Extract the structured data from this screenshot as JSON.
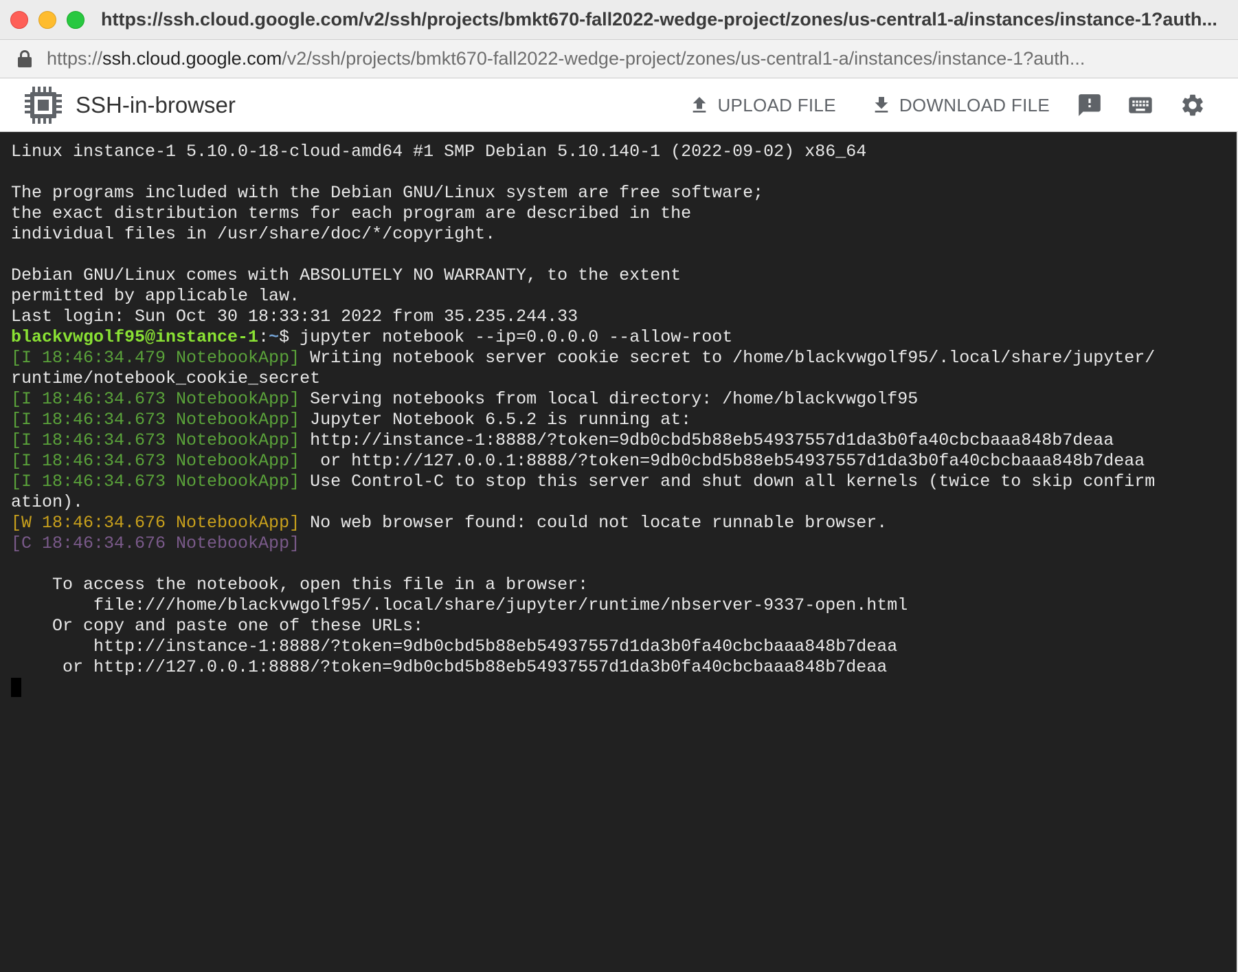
{
  "window": {
    "title": "https://ssh.cloud.google.com/v2/ssh/projects/bmkt670-fall2022-wedge-project/zones/us-central1-a/instances/instance-1?auth..."
  },
  "urlbar": {
    "scheme": "https://",
    "host": "ssh.cloud.google.com",
    "path": "/v2/ssh/projects/bmkt670-fall2022-wedge-project/zones/us-central1-a/instances/instance-1?auth..."
  },
  "appbar": {
    "title": "SSH-in-browser",
    "upload_label": "UPLOAD FILE",
    "download_label": "DOWNLOAD FILE",
    "icons": [
      "chip-icon",
      "upload-icon",
      "download-icon",
      "feedback-icon",
      "keyboard-icon",
      "gear-icon"
    ]
  },
  "colors": {
    "terminal_bg": "#212121",
    "terminal_fg": "#e8e8e8",
    "log_info": "#5aa23a",
    "log_warn": "#c8a01c",
    "log_critical": "#7a5a8a",
    "prompt_user": "#8ae234",
    "prompt_path": "#729fcf"
  },
  "terminal": {
    "motd": [
      "Linux instance-1 5.10.0-18-cloud-amd64 #1 SMP Debian 5.10.140-1 (2022-09-02) x86_64",
      "",
      "The programs included with the Debian GNU/Linux system are free software;",
      "the exact distribution terms for each program are described in the",
      "individual files in /usr/share/doc/*/copyright.",
      "",
      "Debian GNU/Linux comes with ABSOLUTELY NO WARRANTY, to the extent",
      "permitted by applicable law.",
      "Last login: Sun Oct 30 18:33:31 2022 from 35.235.244.33"
    ],
    "prompt": {
      "user_host": "blackvwgolf95@instance-1",
      "sep": ":",
      "path": "~",
      "symbol": "$ ",
      "command": "jupyter notebook --ip=0.0.0.0 --allow-root"
    },
    "log": [
      {
        "tag": "[I 18:46:34.479 NotebookApp]",
        "msg": " Writing notebook server cookie secret to /home/blackvwgolf95/.local/share/jupyter/"
      },
      {
        "tag": "",
        "msg": "runtime/notebook_cookie_secret"
      },
      {
        "tag": "[I 18:46:34.673 NotebookApp]",
        "msg": " Serving notebooks from local directory: /home/blackvwgolf95"
      },
      {
        "tag": "[I 18:46:34.673 NotebookApp]",
        "msg": " Jupyter Notebook 6.5.2 is running at:"
      },
      {
        "tag": "[I 18:46:34.673 NotebookApp]",
        "msg": " http://instance-1:8888/?token=9db0cbd5b88eb54937557d1da3b0fa40cbcbaaa848b7deaa"
      },
      {
        "tag": "[I 18:46:34.673 NotebookApp]",
        "msg": "  or http://127.0.0.1:8888/?token=9db0cbd5b88eb54937557d1da3b0fa40cbcbaaa848b7deaa"
      },
      {
        "tag": "[I 18:46:34.673 NotebookApp]",
        "msg": " Use Control-C to stop this server and shut down all kernels (twice to skip confirm"
      },
      {
        "tag": "",
        "msg": "ation)."
      },
      {
        "tag": "[W 18:46:34.676 NotebookApp]",
        "msg": " No web browser found: could not locate runnable browser."
      },
      {
        "tag": "[C 18:46:34.676 NotebookApp]",
        "msg": ""
      }
    ],
    "access": [
      "",
      "    To access the notebook, open this file in a browser:",
      "        file:///home/blackvwgolf95/.local/share/jupyter/runtime/nbserver-9337-open.html",
      "    Or copy and paste one of these URLs:",
      "        http://instance-1:8888/?token=9db0cbd5b88eb54937557d1da3b0fa40cbcbaaa848b7deaa",
      "     or http://127.0.0.1:8888/?token=9db0cbd5b88eb54937557d1da3b0fa40cbcbaaa848b7deaa"
    ]
  }
}
